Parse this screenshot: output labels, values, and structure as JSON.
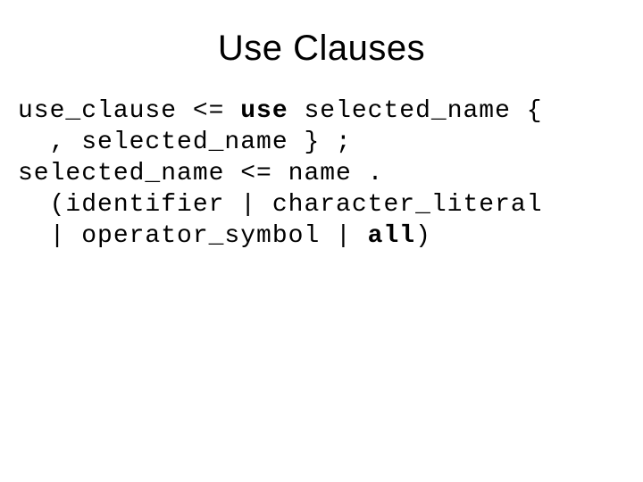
{
  "title": "Use Clauses",
  "grammar": {
    "l1": "use_clause <= ",
    "kw_use": "use",
    "l1b": " selected_name {",
    "l2": "  , selected_name } ;",
    "l3": "selected_name <= name .",
    "l4": "  (identifier | character_literal",
    "l5": "  | operator_symbol | ",
    "kw_all": "all",
    "l5b": ")"
  }
}
